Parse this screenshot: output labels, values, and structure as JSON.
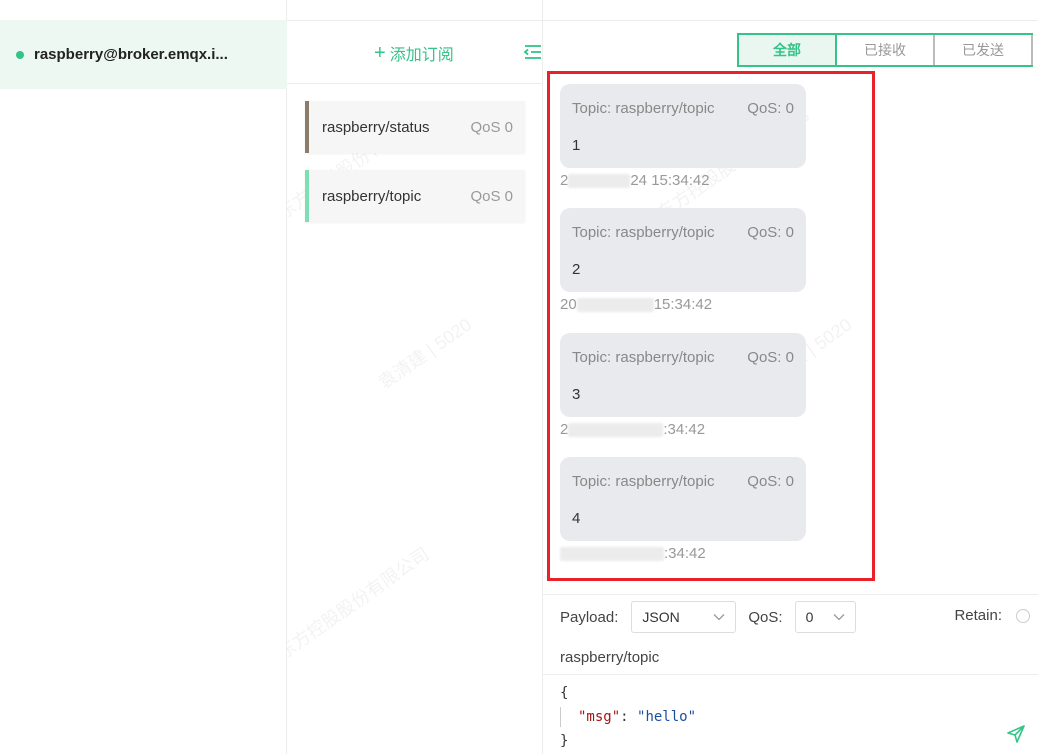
{
  "connections": [
    {
      "name": "raspberry@broker.emqx.i...",
      "status_color": "#34c388"
    }
  ],
  "subscriptions_panel": {
    "add_label": "添加订阅",
    "items": [
      {
        "topic": "raspberry/status",
        "qos": "QoS 0",
        "color": "#8e7c6a"
      },
      {
        "topic": "raspberry/topic",
        "qos": "QoS 0",
        "color": "#7de0b4"
      }
    ]
  },
  "filters": {
    "all": "全部",
    "received": "已接收",
    "sent": "已发送",
    "active": "all"
  },
  "messages": [
    {
      "topic": "Topic: raspberry/topic",
      "qos": "QoS: 0",
      "payload": "1",
      "time_prefix": "2",
      "time_suffix": "24 15:34:42"
    },
    {
      "topic": "Topic: raspberry/topic",
      "qos": "QoS: 0",
      "payload": "2",
      "time_prefix": "20",
      "time_suffix": "15:34:42"
    },
    {
      "topic": "Topic: raspberry/topic",
      "qos": "QoS: 0",
      "payload": "3",
      "time_prefix": "2",
      "time_suffix": ":34:42"
    },
    {
      "topic": "Topic: raspberry/topic",
      "qos": "QoS: 0",
      "payload": "4",
      "time_prefix": "",
      "time_suffix": ":34:42"
    }
  ],
  "publish": {
    "payload_label": "Payload:",
    "payload_format": "JSON",
    "qos_label": "QoS:",
    "qos_value": "0",
    "retain_label": "Retain:",
    "topic": "raspberry/topic",
    "body": {
      "open_brace": "{",
      "key": "\"msg\"",
      "colon": ": ",
      "value": "\"hello\"",
      "close_brace": "}"
    }
  },
  "colors": {
    "accent": "#34c388",
    "highlight_box": "#e8212a"
  },
  "watermark": {
    "company": "日出东方控股股份有限公司",
    "user": "袁清建 | 5020"
  }
}
